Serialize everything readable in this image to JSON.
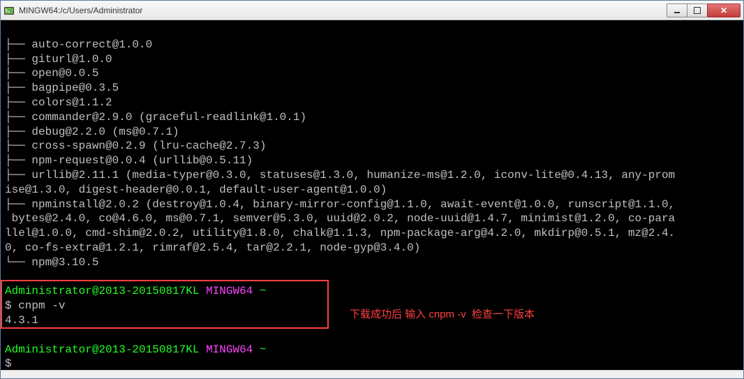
{
  "window": {
    "title": "MINGW64:/c/Users/Administrator"
  },
  "terminal": {
    "lines": [
      "├── auto-correct@1.0.0",
      "├── giturl@1.0.0",
      "├── open@0.0.5",
      "├── bagpipe@0.3.5",
      "├── colors@1.1.2",
      "├── commander@2.9.0 (graceful-readlink@1.0.1)",
      "├── debug@2.2.0 (ms@0.7.1)",
      "├── cross-spawn@0.2.9 (lru-cache@2.7.3)",
      "├── npm-request@0.0.4 (urllib@0.5.11)",
      "├── urllib@2.11.1 (media-typer@0.3.0, statuses@1.3.0, humanize-ms@1.2.0, iconv-lite@0.4.13, any-promise@1.3.0, digest-header@0.0.1, default-user-agent@1.0.0)",
      "├── npminstall@2.0.2 (destroy@1.0.4, binary-mirror-config@1.1.0, await-event@1.0.0, runscript@1.1.0, bytes@2.4.0, co@4.6.0, ms@0.7.1, semver@5.3.0, uuid@2.0.2, node-uuid@1.4.7, minimist@1.2.0, co-parallel@1.0.0, cmd-shim@2.0.2, utility@1.8.0, chalk@1.1.3, npm-package-arg@4.2.0, mkdirp@0.5.1, mz@2.4.0, co-fs-extra@1.2.1, rimraf@2.5.4, tar@2.2.1, node-gyp@3.4.0)",
      "└── npm@3.10.5"
    ],
    "prompt1": {
      "user": "Administrator@2013-20150817KL",
      "env": "MINGW64",
      "path": "~",
      "command": "cnpm -v",
      "output": "4.3.1"
    },
    "prompt2": {
      "user": "Administrator@2013-20150817KL",
      "env": "MINGW64",
      "path": "~",
      "command": ""
    }
  },
  "annotation": "下载成功后 输入 cnpm -v  检查一下版本"
}
